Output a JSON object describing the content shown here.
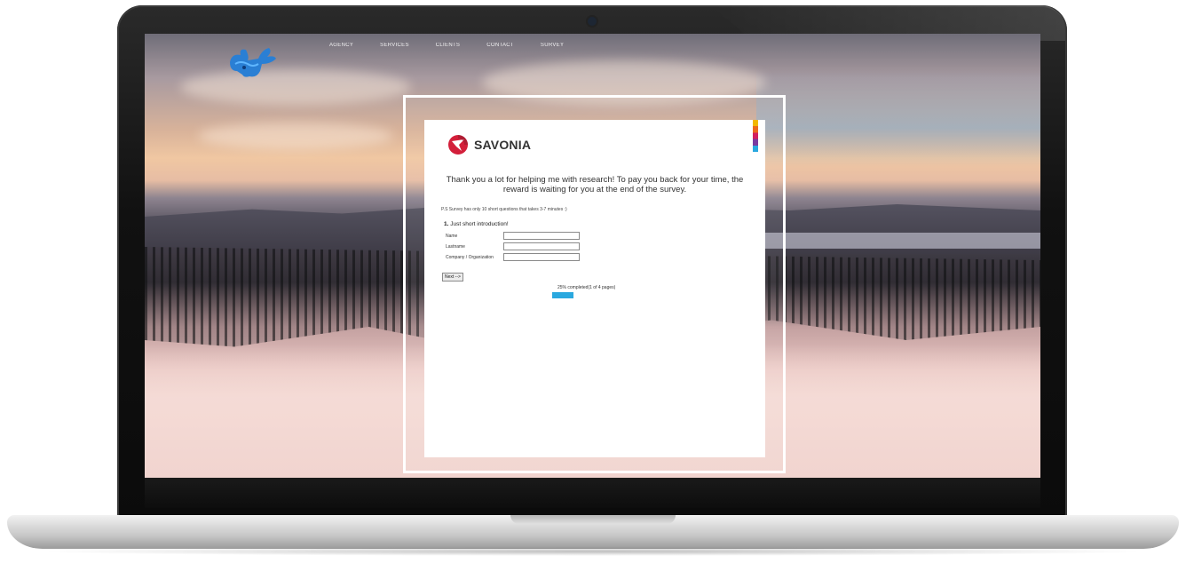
{
  "site": {
    "logo_icon": "moose-logo",
    "nav": [
      "AGENCY",
      "SERVICES",
      "CLIENTS",
      "CONTACT",
      "SURVEY"
    ]
  },
  "survey": {
    "brand_name": "SAVONIA",
    "brand_icon": "savonia-logo",
    "thanks": "Thank you a lot for helping me with research! To pay you back for your time, the reward is waiting for you at the end of the survey.",
    "ps": "P.S Survey has only 10 short questions that takes 3-7 minutes :)",
    "question_number": "1.",
    "question_title": "Just short introduction!",
    "fields": [
      {
        "label": "Name",
        "value": ""
      },
      {
        "label": "Lastname",
        "value": ""
      },
      {
        "label": "Company / Organization",
        "value": ""
      }
    ],
    "next_label": "Next -->",
    "progress_text": "25% completed(1 of 4 pages)",
    "progress_fraction": 0.25
  },
  "colors": {
    "progress": "#2aa8df",
    "brand_red": "#d31f3a"
  }
}
